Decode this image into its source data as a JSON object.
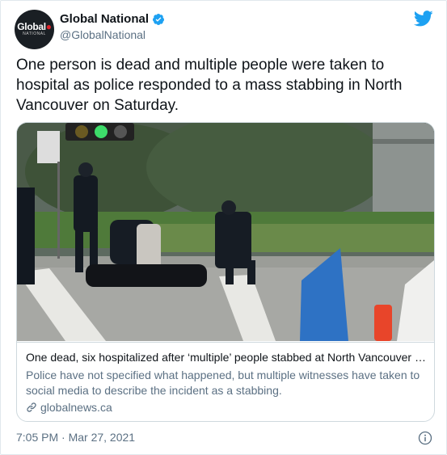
{
  "author": {
    "name": "Global National",
    "handle": "@GlobalNational",
    "verified": true,
    "avatar_text": "Global",
    "avatar_subtext": "NATIONAL"
  },
  "icons": {
    "brand": "twitter-bird-icon",
    "verified": "verified-badge-icon",
    "link": "link-icon",
    "info": "info-icon"
  },
  "tweet": {
    "text": "One person is dead and multiple people were taken to hospital as police responded to a mass stabbing in North Vancouver on Saturday."
  },
  "card": {
    "title": "One dead, six hospitalized after ‘multiple’ people stabbed at North Vancouver library",
    "description": "Police have not specified what happened, but multiple witnesses have taken to social media to describe the incident as a stabbing.",
    "domain": "globalnews.ca"
  },
  "footer": {
    "timestamp": "7:05 PM · Mar 27, 2021"
  },
  "colors": {
    "brand_blue": "#1da1f2",
    "secondary_text": "#5b7083",
    "border": "#cfd9de"
  }
}
